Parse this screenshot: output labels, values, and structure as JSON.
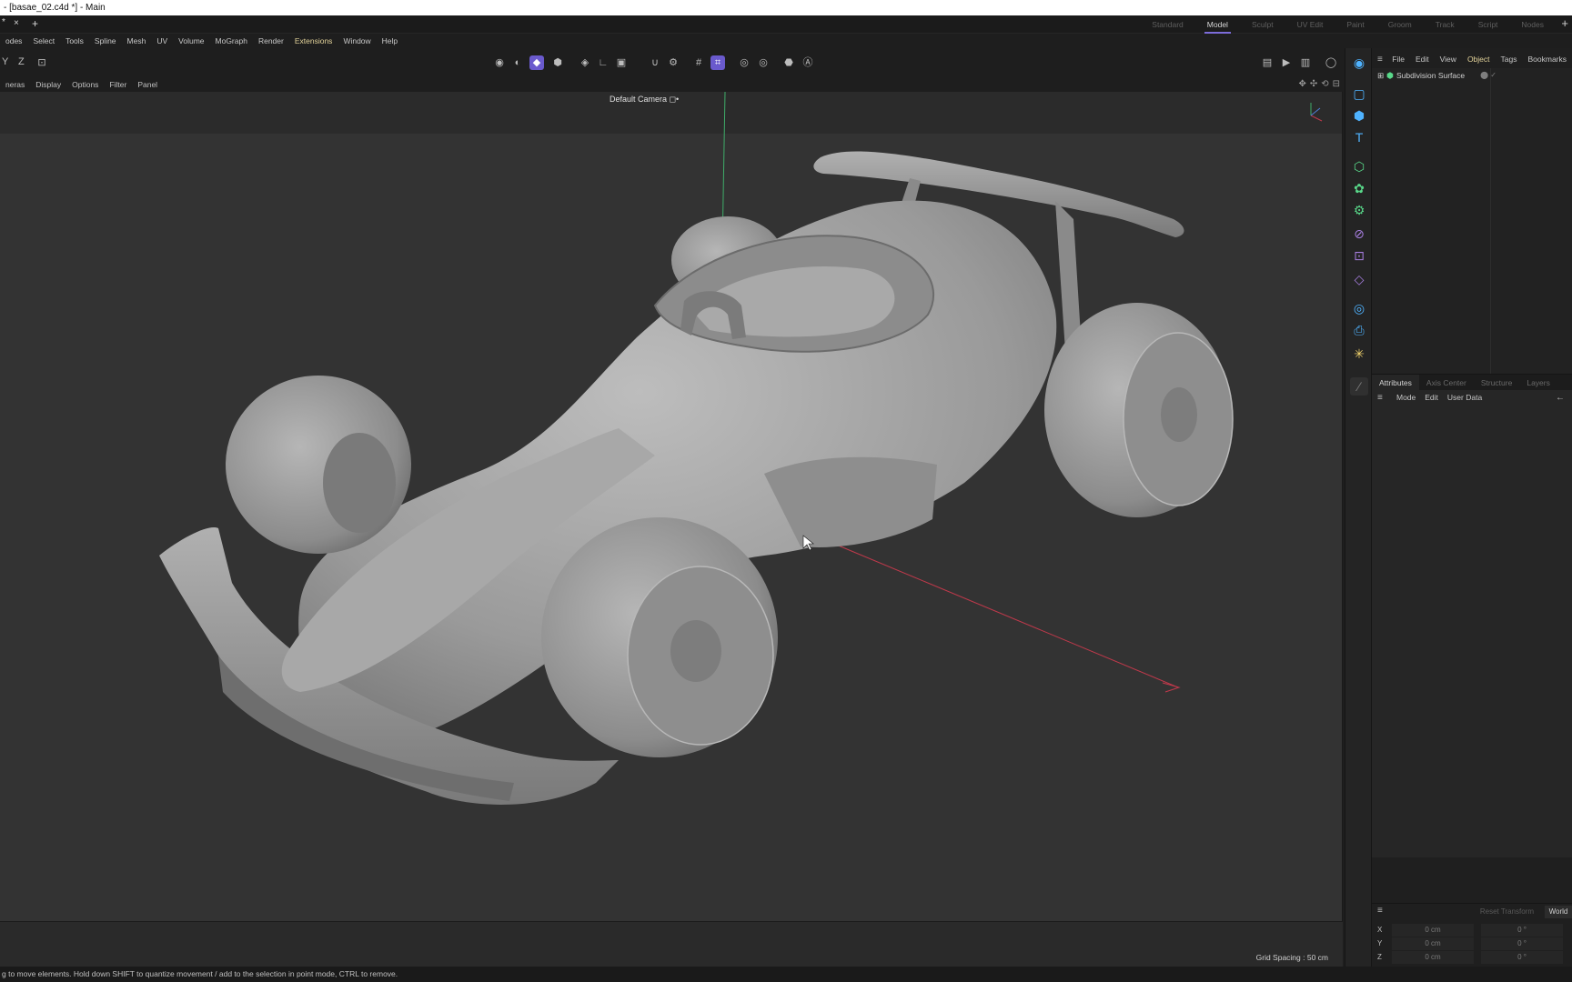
{
  "window": {
    "title": "- [basae_02.c4d *] - Main"
  },
  "tabs": {
    "doc_mark": "*",
    "close_icon": "×",
    "add_icon": "+",
    "layout_add_icon": "+"
  },
  "layouts": [
    "Standard",
    "Model",
    "Sculpt",
    "UV Edit",
    "Paint",
    "Groom",
    "Track",
    "Script",
    "Nodes"
  ],
  "active_layout": "Model",
  "menu": [
    "odes",
    "Select",
    "Tools",
    "Spline",
    "Mesh",
    "UV",
    "Volume",
    "MoGraph",
    "Render",
    "Extensions",
    "Window",
    "Help"
  ],
  "toolbar": {
    "axis_y": "Y",
    "axis_z": "Z",
    "coord_icon": "coordinate-system-icon"
  },
  "viewport_menu": [
    "neras",
    "Display",
    "Options",
    "Filter",
    "Panel"
  ],
  "viewport": {
    "camera_label": "Default Camera ◻•",
    "grid_spacing": "Grid Spacing : 50 cm",
    "axis_colors": {
      "x": "#c0394b",
      "y": "#3fae6a"
    }
  },
  "status": "g to move elements. Hold down SHIFT to quantize movement / add to the selection in point mode, CTRL to remove.",
  "object_manager": {
    "menu": [
      "File",
      "Edit",
      "View",
      "Object",
      "Tags",
      "Bookmarks"
    ],
    "active_menu": "Object",
    "objects": [
      {
        "name": "Subdivision Surface",
        "icon": "subdivision-icon"
      }
    ]
  },
  "attributes": {
    "tabs": [
      "Attributes",
      "Axis Center",
      "Structure",
      "Layers"
    ],
    "active_tab": "Attributes",
    "menu": [
      "Mode",
      "Edit",
      "User Data"
    ]
  },
  "coordinates": {
    "reset_label": "Reset Transform",
    "space": "World",
    "rows": [
      {
        "axis": "X",
        "pos": "0 cm",
        "rot": "0 °"
      },
      {
        "axis": "Y",
        "pos": "0 cm",
        "rot": "0 °"
      },
      {
        "axis": "Z",
        "pos": "0 cm",
        "rot": "0 °"
      }
    ]
  },
  "colors": {
    "accent": "#6a5acd",
    "viewport_bg": "#333333",
    "panel_bg": "#1f1f1f"
  }
}
